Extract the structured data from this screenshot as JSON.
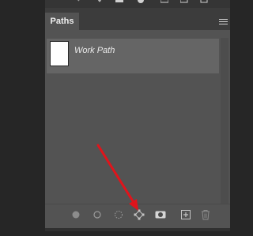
{
  "panel": {
    "tab_label": "Paths",
    "menu_icon": "panel-menu-icon"
  },
  "paths": [
    {
      "name": "Work Path",
      "thumbnail_color": "#ffffff"
    }
  ],
  "toolbar": {
    "buttons": [
      "fill-path-icon",
      "stroke-path-icon",
      "load-as-selection-icon",
      "make-work-path-icon",
      "add-mask-icon",
      "new-path-icon",
      "delete-path-icon"
    ]
  },
  "colors": {
    "background": "#262626",
    "panel": "#535353",
    "tabbar": "#3c3c3c",
    "selected_row": "#656565",
    "annotation_arrow": "#e0141b"
  }
}
